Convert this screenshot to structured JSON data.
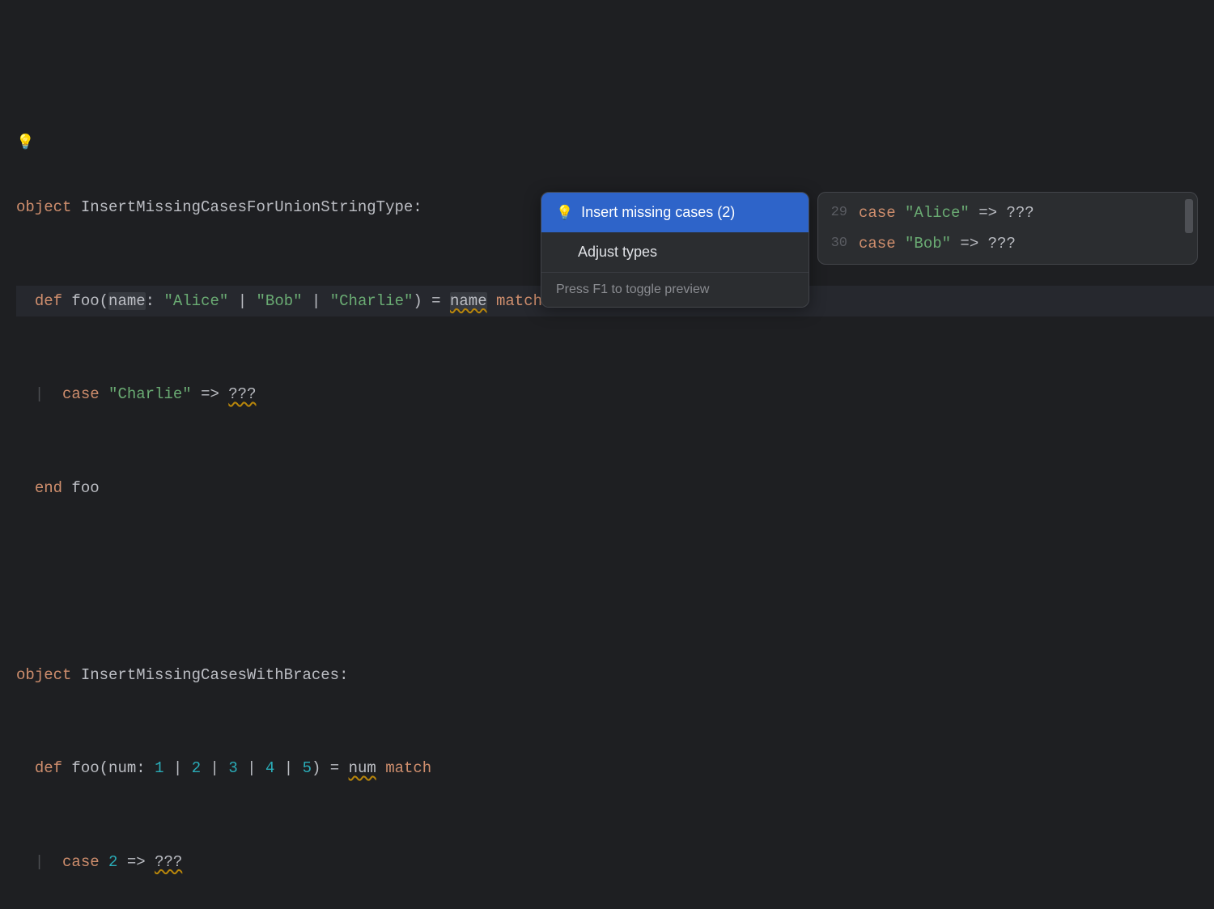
{
  "code": {
    "l1_kw": "object",
    "l1_name": " InsertMissingCasesForUnionStringType:",
    "l2_def": "def",
    "l2_foo": " foo(",
    "l2_param": "name",
    "l2_colon": ": ",
    "l2_s1": "\"Alice\"",
    "l2_pipe": " | ",
    "l2_s2": "\"Bob\"",
    "l2_s3": "\"Charlie\"",
    "l2_close": ") = ",
    "l2_name2": "name",
    "l2_match": " match",
    "l3_case": "case",
    "l3_str": " \"Charlie\"",
    "l3_arrow": " => ",
    "l3_q": "???",
    "l4_end": "end",
    "l4_foo": " foo",
    "l6_kw": "object",
    "l6_name": " InsertMissingCasesWithBraces:",
    "l7_def": "def",
    "l7_foo": " foo(num: ",
    "l7_n1": "1",
    "l7_pipe": " | ",
    "l7_n2": "2",
    "l7_n3": "3",
    "l7_n4": "4",
    "l7_n5": "5",
    "l7_close": ") = ",
    "l7_num": "num",
    "l7_match": " match",
    "l8_case": "case",
    "l8_n": "2",
    "l8_arrow": " => ",
    "l8_q": "???"
  },
  "popup": {
    "item1": "Insert missing cases (2)",
    "item2": "Adjust types",
    "footer": "Press F1 to toggle preview"
  },
  "preview": {
    "n1": "29",
    "n2": "30",
    "p1_case": "case",
    "p1_str": " \"Alice\"",
    "p1_arrow": " => ",
    "p1_q": "???",
    "p2_case": "case",
    "p2_str": " \"Bob\"",
    "p2_arrow": " => ",
    "p2_q": "???"
  },
  "bulb": "💡"
}
